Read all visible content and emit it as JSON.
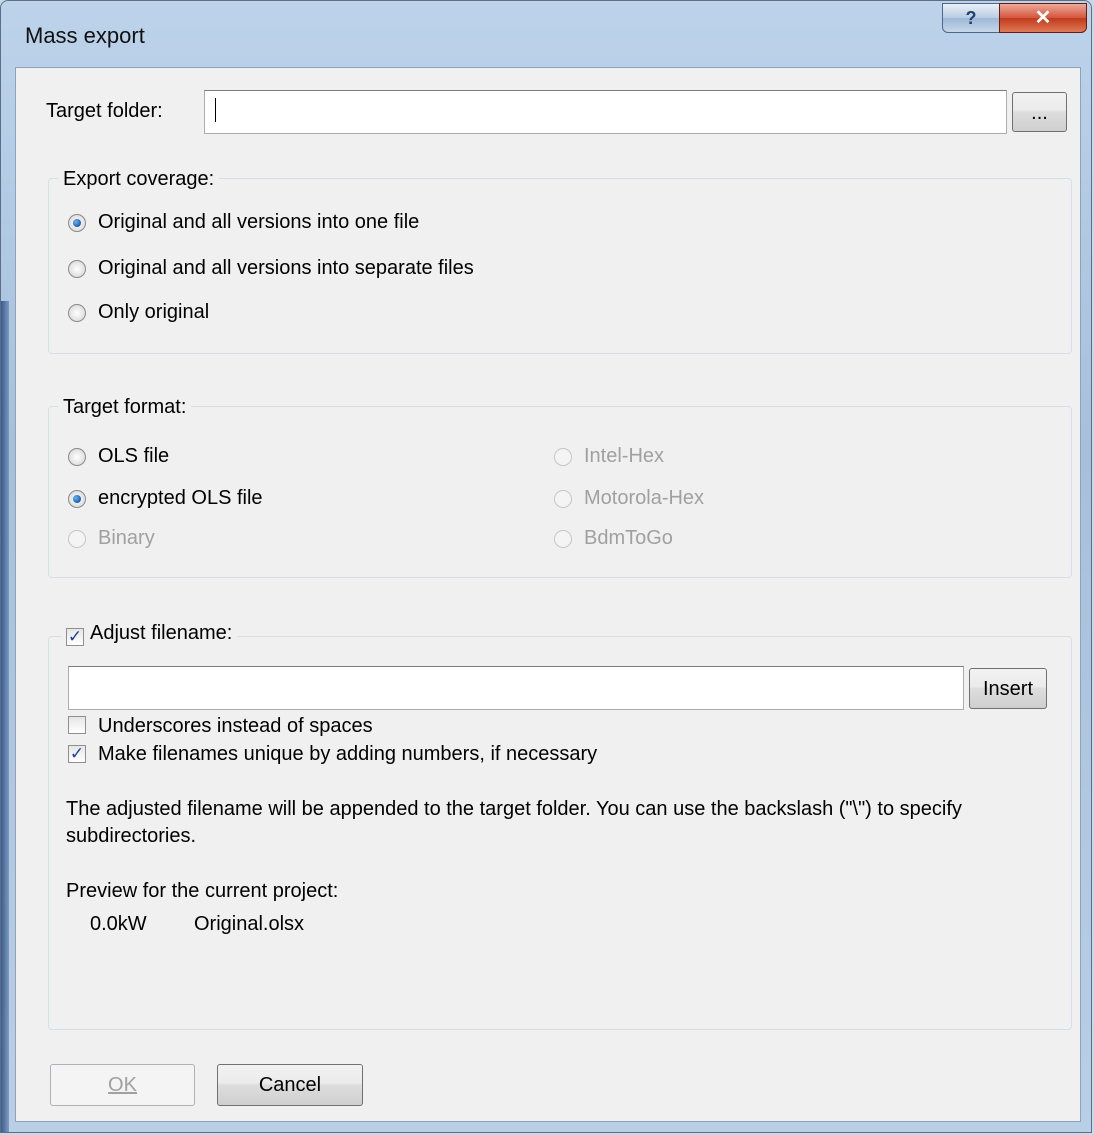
{
  "window": {
    "title": "Mass export",
    "help_glyph": "?",
    "close_glyph": "✕"
  },
  "target_folder": {
    "label": "Target  folder:",
    "value": "",
    "browse_label": "..."
  },
  "export_coverage": {
    "legend": "Export coverage:",
    "options": [
      {
        "label": "Original and all versions into one file",
        "checked": true
      },
      {
        "label": "Original and all versions into separate files",
        "checked": false
      },
      {
        "label": "Only original",
        "checked": false
      }
    ]
  },
  "target_format": {
    "legend": "Target format:",
    "options": [
      {
        "label": "OLS file",
        "checked": false,
        "enabled": true
      },
      {
        "label": "encrypted OLS file",
        "checked": true,
        "enabled": true
      },
      {
        "label": "Binary",
        "checked": false,
        "enabled": false
      },
      {
        "label": "Intel-Hex",
        "checked": false,
        "enabled": false
      },
      {
        "label": "Motorola-Hex",
        "checked": false,
        "enabled": false
      },
      {
        "label": "BdmToGo",
        "checked": false,
        "enabled": false
      }
    ]
  },
  "adjust_filename": {
    "legend": "Adjust filename:",
    "checked": true,
    "pattern_value": "",
    "insert_label": "Insert",
    "underscores_label": "Underscores instead of spaces",
    "underscores_checked": false,
    "unique_label": "Make filenames unique by adding numbers, if necessary",
    "unique_checked": true,
    "info_line1": "The adjusted filename will be appended to the target folder. You can use the backslash (\"\\\") to specify",
    "info_line2": "subdirectories.",
    "preview_label": "Preview for the current project:",
    "preview_size": "0.0kW",
    "preview_file": "Original.olsx"
  },
  "buttons": {
    "ok_label": "OK",
    "cancel_label": "Cancel"
  }
}
